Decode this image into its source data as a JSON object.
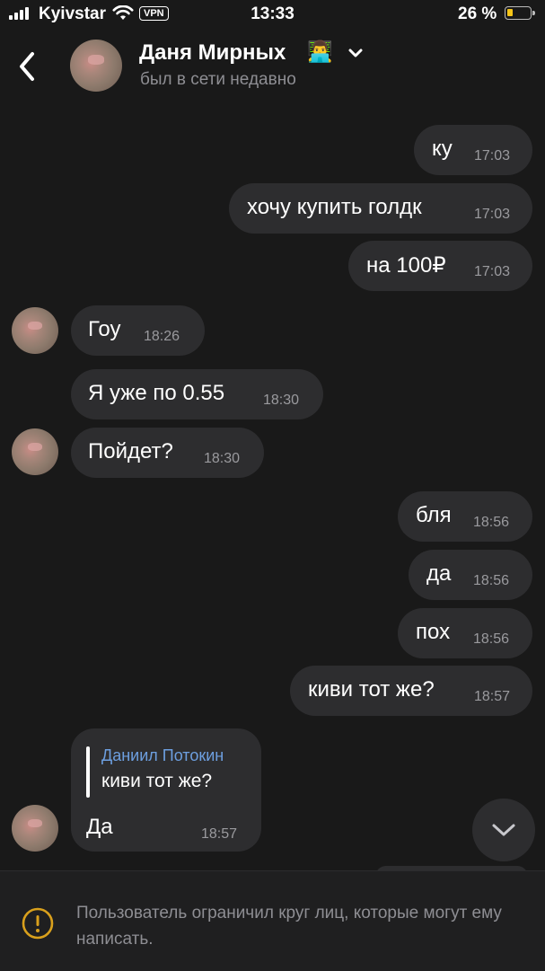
{
  "status_bar": {
    "carrier": "Kyivstar",
    "vpn": "VPN",
    "time": "13:33",
    "battery_percent": "26 %",
    "battery_level": 0.26
  },
  "header": {
    "name": "Даня Мирных",
    "emoji": "👨‍💻",
    "status": "был в сети недавно"
  },
  "messages": [
    {
      "text": "ку",
      "time": "17:03"
    },
    {
      "text": "хочу купить голдк",
      "time": "17:03"
    },
    {
      "text": "на 100₽",
      "time": "17:03"
    },
    {
      "text": "Гоу",
      "time": "18:26"
    },
    {
      "text": "Я уже по 0.55",
      "time": "18:30"
    },
    {
      "text": "Пойдет?",
      "time": "18:30"
    },
    {
      "text": "бля",
      "time": "18:56"
    },
    {
      "text": "да",
      "time": "18:56"
    },
    {
      "text": "пох",
      "time": "18:56"
    },
    {
      "text": "киви тот же?",
      "time": "18:57"
    }
  ],
  "reply_message": {
    "quote_author": "Даниил Потокин",
    "quote_text": "киви тот же?",
    "text": "Да",
    "time": "18:57"
  },
  "notice": {
    "text": "Пользователь ограничил круг лиц, которые могут ему написать."
  },
  "icons": {
    "back": "back-chevron-icon",
    "dropdown": "chevron-down-icon",
    "scroll": "scroll-down-icon",
    "warning": "warning-icon"
  },
  "colors": {
    "background": "#191919",
    "bubble": "#2d2d2f",
    "accent_name": "#6d9fe0",
    "warning": "#d9a01c",
    "battery": "#f5c518"
  }
}
